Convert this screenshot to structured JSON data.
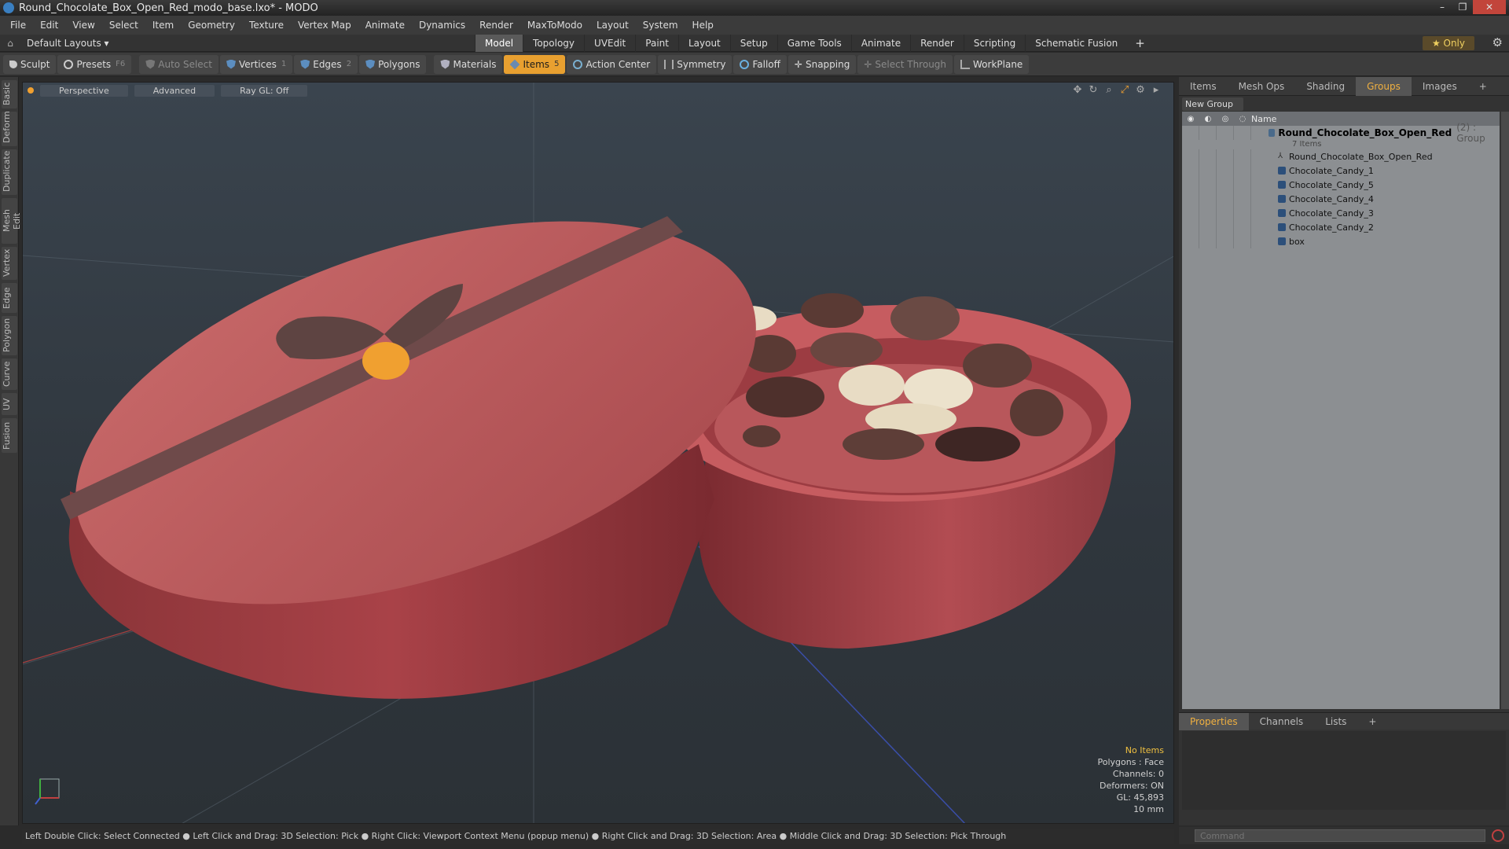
{
  "window": {
    "title": "Round_Chocolate_Box_Open_Red_modo_base.lxo* - MODO",
    "min": "–",
    "max": "❐",
    "close": "✕"
  },
  "menu": [
    "File",
    "Edit",
    "View",
    "Select",
    "Item",
    "Geometry",
    "Texture",
    "Vertex Map",
    "Animate",
    "Dynamics",
    "Render",
    "MaxToModo",
    "Layout",
    "System",
    "Help"
  ],
  "layoutbar": {
    "default_layouts": "Default Layouts ▾",
    "tabs": [
      "Model",
      "Topology",
      "UVEdit",
      "Paint",
      "Layout",
      "Setup",
      "Game Tools",
      "Animate",
      "Render",
      "Scripting",
      "Schematic Fusion"
    ],
    "plus": "+",
    "only": "★ Only"
  },
  "toolbar": {
    "sculpt": "Sculpt",
    "presets": "Presets",
    "presets_key": "F6",
    "auto_select": "Auto Select",
    "vertices": "Vertices",
    "vertices_key": "1",
    "edges": "Edges",
    "edges_key": "2",
    "polygons": "Polygons",
    "materials": "Materials",
    "items": "Items",
    "items_key": "5",
    "action_center": "Action Center",
    "symmetry": "Symmetry",
    "falloff": "Falloff",
    "snapping": "Snapping",
    "select_through": "Select Through",
    "workplane": "WorkPlane"
  },
  "left_tabs": [
    "Basic",
    "Deform",
    "Duplicate",
    "Mesh Edit",
    "Vertex",
    "Edge",
    "Polygon",
    "Curve",
    "UV",
    "Fusion"
  ],
  "viewport": {
    "view": "Perspective",
    "shading": "Advanced",
    "raygl": "Ray GL: Off",
    "info": {
      "items": "No Items",
      "polygons": "Polygons : Face",
      "channels": "Channels: 0",
      "deformers": "Deformers: ON",
      "gl": "GL: 45,893",
      "scale": "10 mm"
    }
  },
  "panel": {
    "tabs": [
      "Items",
      "Mesh Ops",
      "Shading",
      "Groups",
      "Images"
    ],
    "plus": "+",
    "new_group": "New Group",
    "name_header": "Name",
    "group": {
      "name": "Round_Chocolate_Box_Open_Red",
      "count": "(2) : Group",
      "subinfo": "7 Items"
    },
    "items": [
      "Round_Chocolate_Box_Open_Red",
      "Chocolate_Candy_1",
      "Chocolate_Candy_5",
      "Chocolate_Candy_4",
      "Chocolate_Candy_3",
      "Chocolate_Candy_2",
      "box"
    ]
  },
  "bottom_panel": {
    "tabs": [
      "Properties",
      "Channels",
      "Lists"
    ],
    "plus": "+"
  },
  "command": {
    "placeholder": "Command"
  },
  "status": "Left Double Click: Select Connected ● Left Click and Drag: 3D Selection: Pick ● Right Click: Viewport Context Menu (popup menu) ● Right Click and Drag: 3D Selection: Area ● Middle Click and Drag: 3D Selection: Pick Through"
}
